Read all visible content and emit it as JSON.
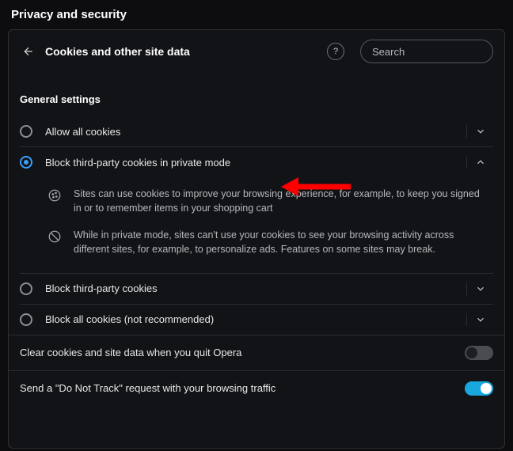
{
  "page_title": "Privacy and security",
  "header": {
    "title": "Cookies and other site data",
    "search_placeholder": "Search"
  },
  "section_label": "General settings",
  "options": [
    {
      "label": "Allow all cookies",
      "selected": false,
      "expanded": false
    },
    {
      "label": "Block third-party cookies in private mode",
      "selected": true,
      "expanded": true
    },
    {
      "label": "Block third-party cookies",
      "selected": false,
      "expanded": false
    },
    {
      "label": "Block all cookies (not recommended)",
      "selected": false,
      "expanded": false
    }
  ],
  "detail": {
    "line1": "Sites can use cookies to improve your browsing experience, for example, to keep you signed in or to remember items in your shopping cart",
    "line2": "While in private mode, sites can't use your cookies to see your browsing activity across different sites, for example, to personalize ads. Features on some sites may break."
  },
  "switches": [
    {
      "label": "Clear cookies and site data when you quit Opera",
      "on": false
    },
    {
      "label": "Send a \"Do Not Track\" request with your browsing traffic",
      "on": true
    }
  ],
  "annotation_arrow_color": "#ff0000"
}
